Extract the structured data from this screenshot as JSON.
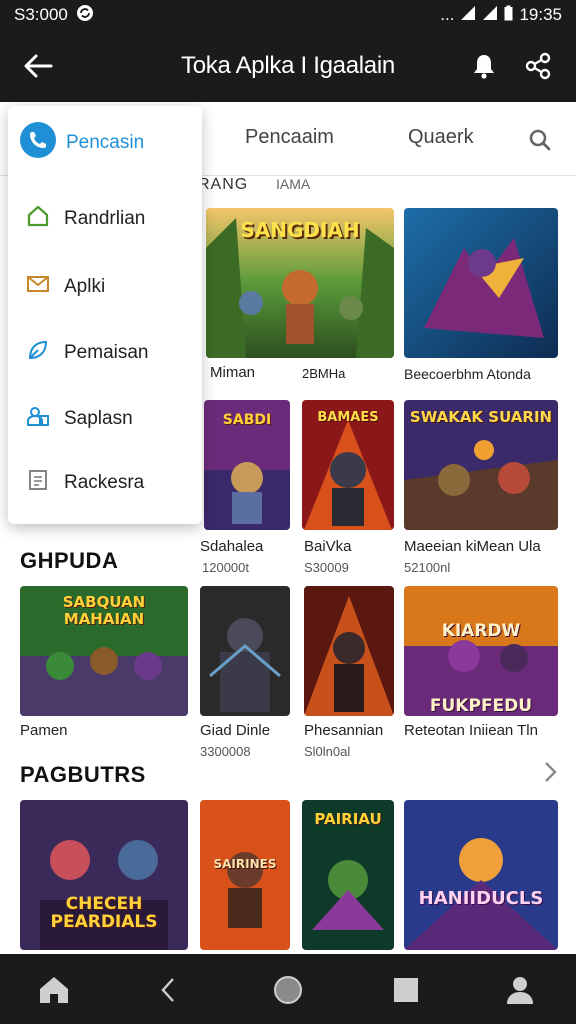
{
  "status_bar": {
    "left_text": "S3:000",
    "time": "19:35",
    "dots": "..."
  },
  "app_bar": {
    "title": "Toka Aplka I Igaalain"
  },
  "tabs": [
    {
      "label": "Pencaaim"
    },
    {
      "label": "Quaerk"
    }
  ],
  "partial_headers": {
    "left": "RANG",
    "right": "IAMA"
  },
  "drawer": {
    "header": "Pencasin",
    "items": [
      {
        "label": "Randrlian",
        "icon": "house-icon"
      },
      {
        "label": "Aplki",
        "icon": "envelope-icon"
      },
      {
        "label": "Pemaisan",
        "icon": "leaf-icon"
      },
      {
        "label": "Saplasn",
        "icon": "people-icon"
      },
      {
        "label": "Rackesra",
        "icon": "document-icon"
      }
    ]
  },
  "row1": [
    {
      "caption": "Miman",
      "subtitle": "",
      "art_title": "SANGDIAH"
    },
    {
      "caption": "2BMHa",
      "subtitle": "",
      "art_title": ""
    },
    {
      "caption": "Beecoerbhm Atonda",
      "subtitle": "",
      "art_title": ""
    }
  ],
  "row2": [
    {
      "caption": "Sdahalea",
      "subtitle": "120000t",
      "art_title": "SABDI"
    },
    {
      "caption": "BaiVka",
      "subtitle": "S30009",
      "art_title": "BAMAES"
    },
    {
      "caption": "Maeeian kiMean Ula",
      "subtitle": "52100nl",
      "art_title": "SWAKAK SUARIN"
    }
  ],
  "section_ghpuda": {
    "title": "GHPUDA",
    "items": [
      {
        "caption": "Pamen",
        "subtitle": "",
        "art_title": "SABQUAN MAHAIAN"
      },
      {
        "caption": "Giad Dinle",
        "subtitle": "3300008",
        "art_title": ""
      },
      {
        "caption": "Phesannian",
        "subtitle": "Sl0ln0al",
        "art_title": ""
      },
      {
        "caption": "Reteotan Iniiean Tln",
        "subtitle": "",
        "art_title": "KIARDW FUKPFEDU"
      }
    ]
  },
  "section_pagbutrs": {
    "title": "PAGBUTRS",
    "items": [
      {
        "art_title": "CHECEH PEARDIALS"
      },
      {
        "art_title": "SAIRINES NEHCAKN"
      },
      {
        "art_title": "PAIRIAU"
      },
      {
        "art_title": "HANIIDUCLS"
      }
    ]
  },
  "colors": {
    "bar_bg": "#1b1b1b",
    "accent_blue": "#1f8fd6",
    "green_icon": "#4a9a2e"
  }
}
